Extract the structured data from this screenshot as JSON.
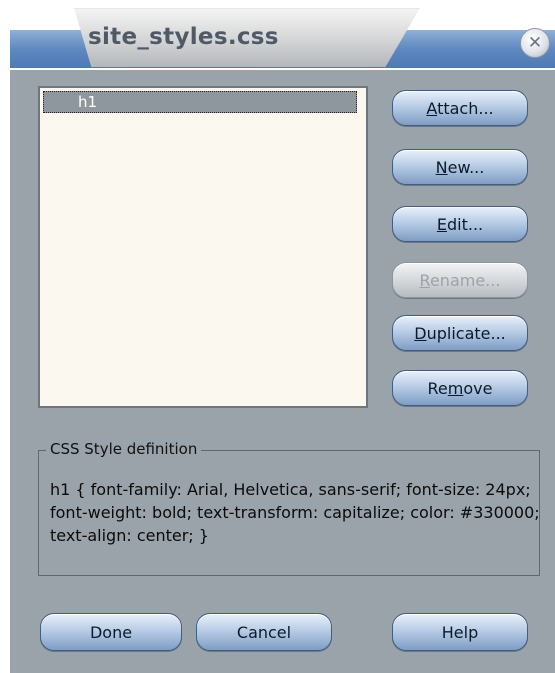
{
  "window": {
    "title": "site_styles.css",
    "close_icon": "close-icon"
  },
  "styles_list": {
    "items": [
      {
        "label": "h1",
        "selected": true
      }
    ]
  },
  "side_buttons": [
    {
      "label_pre": "",
      "label_key": "A",
      "label_post": "ttach...",
      "enabled": true
    },
    {
      "label_pre": "",
      "label_key": "N",
      "label_post": "ew...",
      "enabled": true
    },
    {
      "label_pre": "",
      "label_key": "E",
      "label_post": "dit...",
      "enabled": true
    },
    {
      "label_pre": "",
      "label_key": "R",
      "label_post": "ename...",
      "enabled": false
    },
    {
      "label_pre": "",
      "label_key": "D",
      "label_post": "uplicate...",
      "enabled": true
    },
    {
      "label_pre": "Re",
      "label_key": "m",
      "label_post": "ove",
      "enabled": true
    }
  ],
  "definition": {
    "legend": "CSS Style definition",
    "text": "h1 { font-family: Arial, Helvetica, sans-serif; font-size: 24px; font-weight: bold; text-transform: capitalize; color: #330000; text-align: center; }"
  },
  "bottom_buttons": {
    "done": "Done",
    "cancel": "Cancel",
    "help": "Help"
  },
  "colors": {
    "dialog_bg": "#9aa2aa",
    "list_bg": "#fbf8ef",
    "selection_bg": "#8e969e",
    "accent_blue": "#5c87bf"
  }
}
